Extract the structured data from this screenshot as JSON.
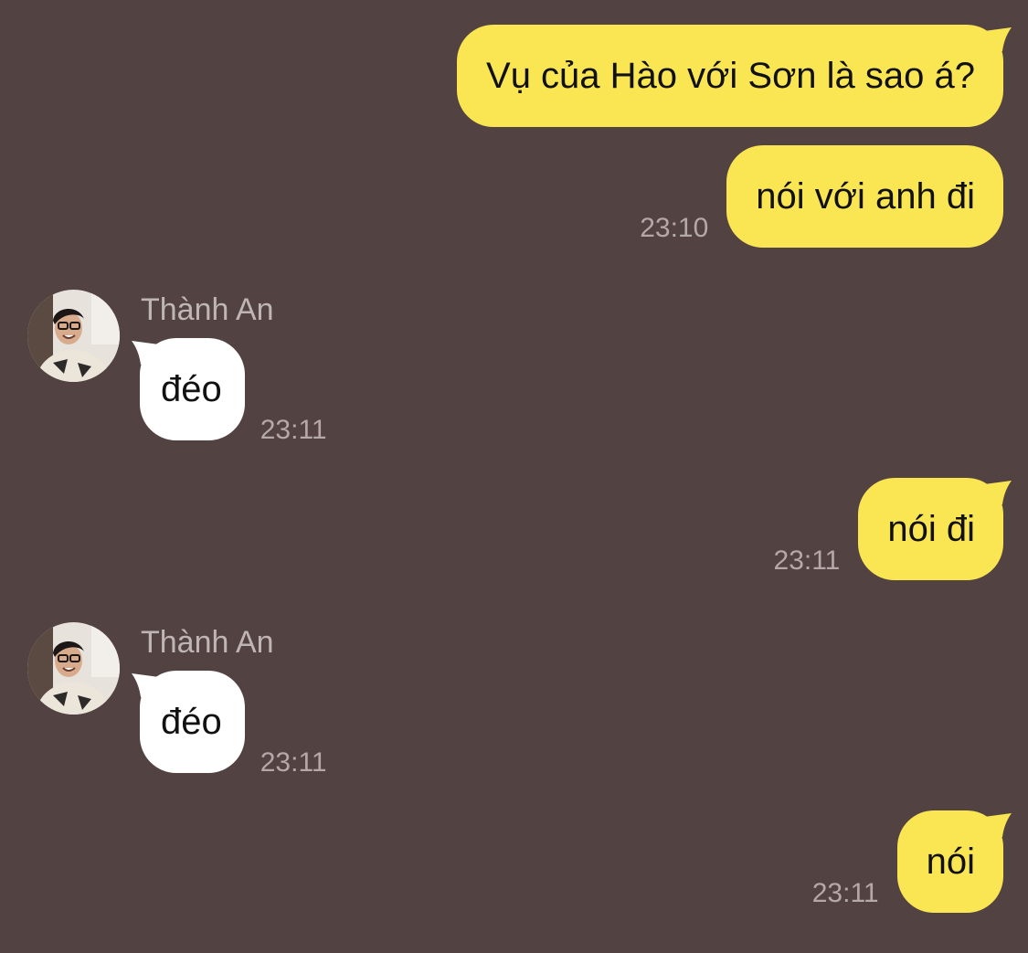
{
  "theme": {
    "background": "#524242",
    "outgoing_bubble": "#fae553",
    "incoming_bubble": "#ffffff",
    "timestamp": "#b4a8a8",
    "sender_name": "#c0b5b5"
  },
  "messages": [
    {
      "direction": "outgoing",
      "text": "Vụ của Hào với Sơn là sao á?",
      "time": ""
    },
    {
      "direction": "outgoing",
      "text": "nói với anh đi",
      "time": "23:10"
    },
    {
      "direction": "incoming",
      "sender": "Thành An",
      "avatar_icon": "avatar-photo",
      "text": "đéo",
      "time": "23:11"
    },
    {
      "direction": "outgoing",
      "text": "nói đi",
      "time": "23:11"
    },
    {
      "direction": "incoming",
      "sender": "Thành An",
      "avatar_icon": "avatar-photo",
      "text": "đéo",
      "time": "23:11"
    },
    {
      "direction": "outgoing",
      "text": "nói",
      "time": "23:11"
    }
  ]
}
